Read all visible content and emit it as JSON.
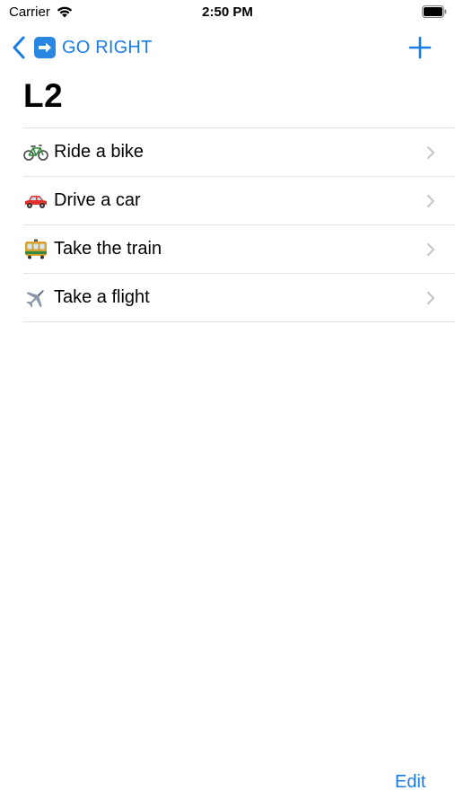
{
  "status_bar": {
    "carrier": "Carrier",
    "time": "2:50 PM"
  },
  "nav": {
    "back_label": "GO RIGHT",
    "back_icon": "right-arrow-emoji-icon",
    "add_icon": "plus-icon"
  },
  "page": {
    "title": "L2"
  },
  "list": {
    "items": [
      {
        "label": "Ride a bike",
        "icon": "bicycle-icon"
      },
      {
        "label": "Drive a car",
        "icon": "car-icon"
      },
      {
        "label": "Take the train",
        "icon": "tram-icon"
      },
      {
        "label": "Take a flight",
        "icon": "airplane-icon"
      }
    ]
  },
  "toolbar": {
    "edit_label": "Edit"
  },
  "colors": {
    "accent": "#1a7ce6",
    "separator": "#e3e3e6",
    "chevron": "#c4c4c7"
  }
}
